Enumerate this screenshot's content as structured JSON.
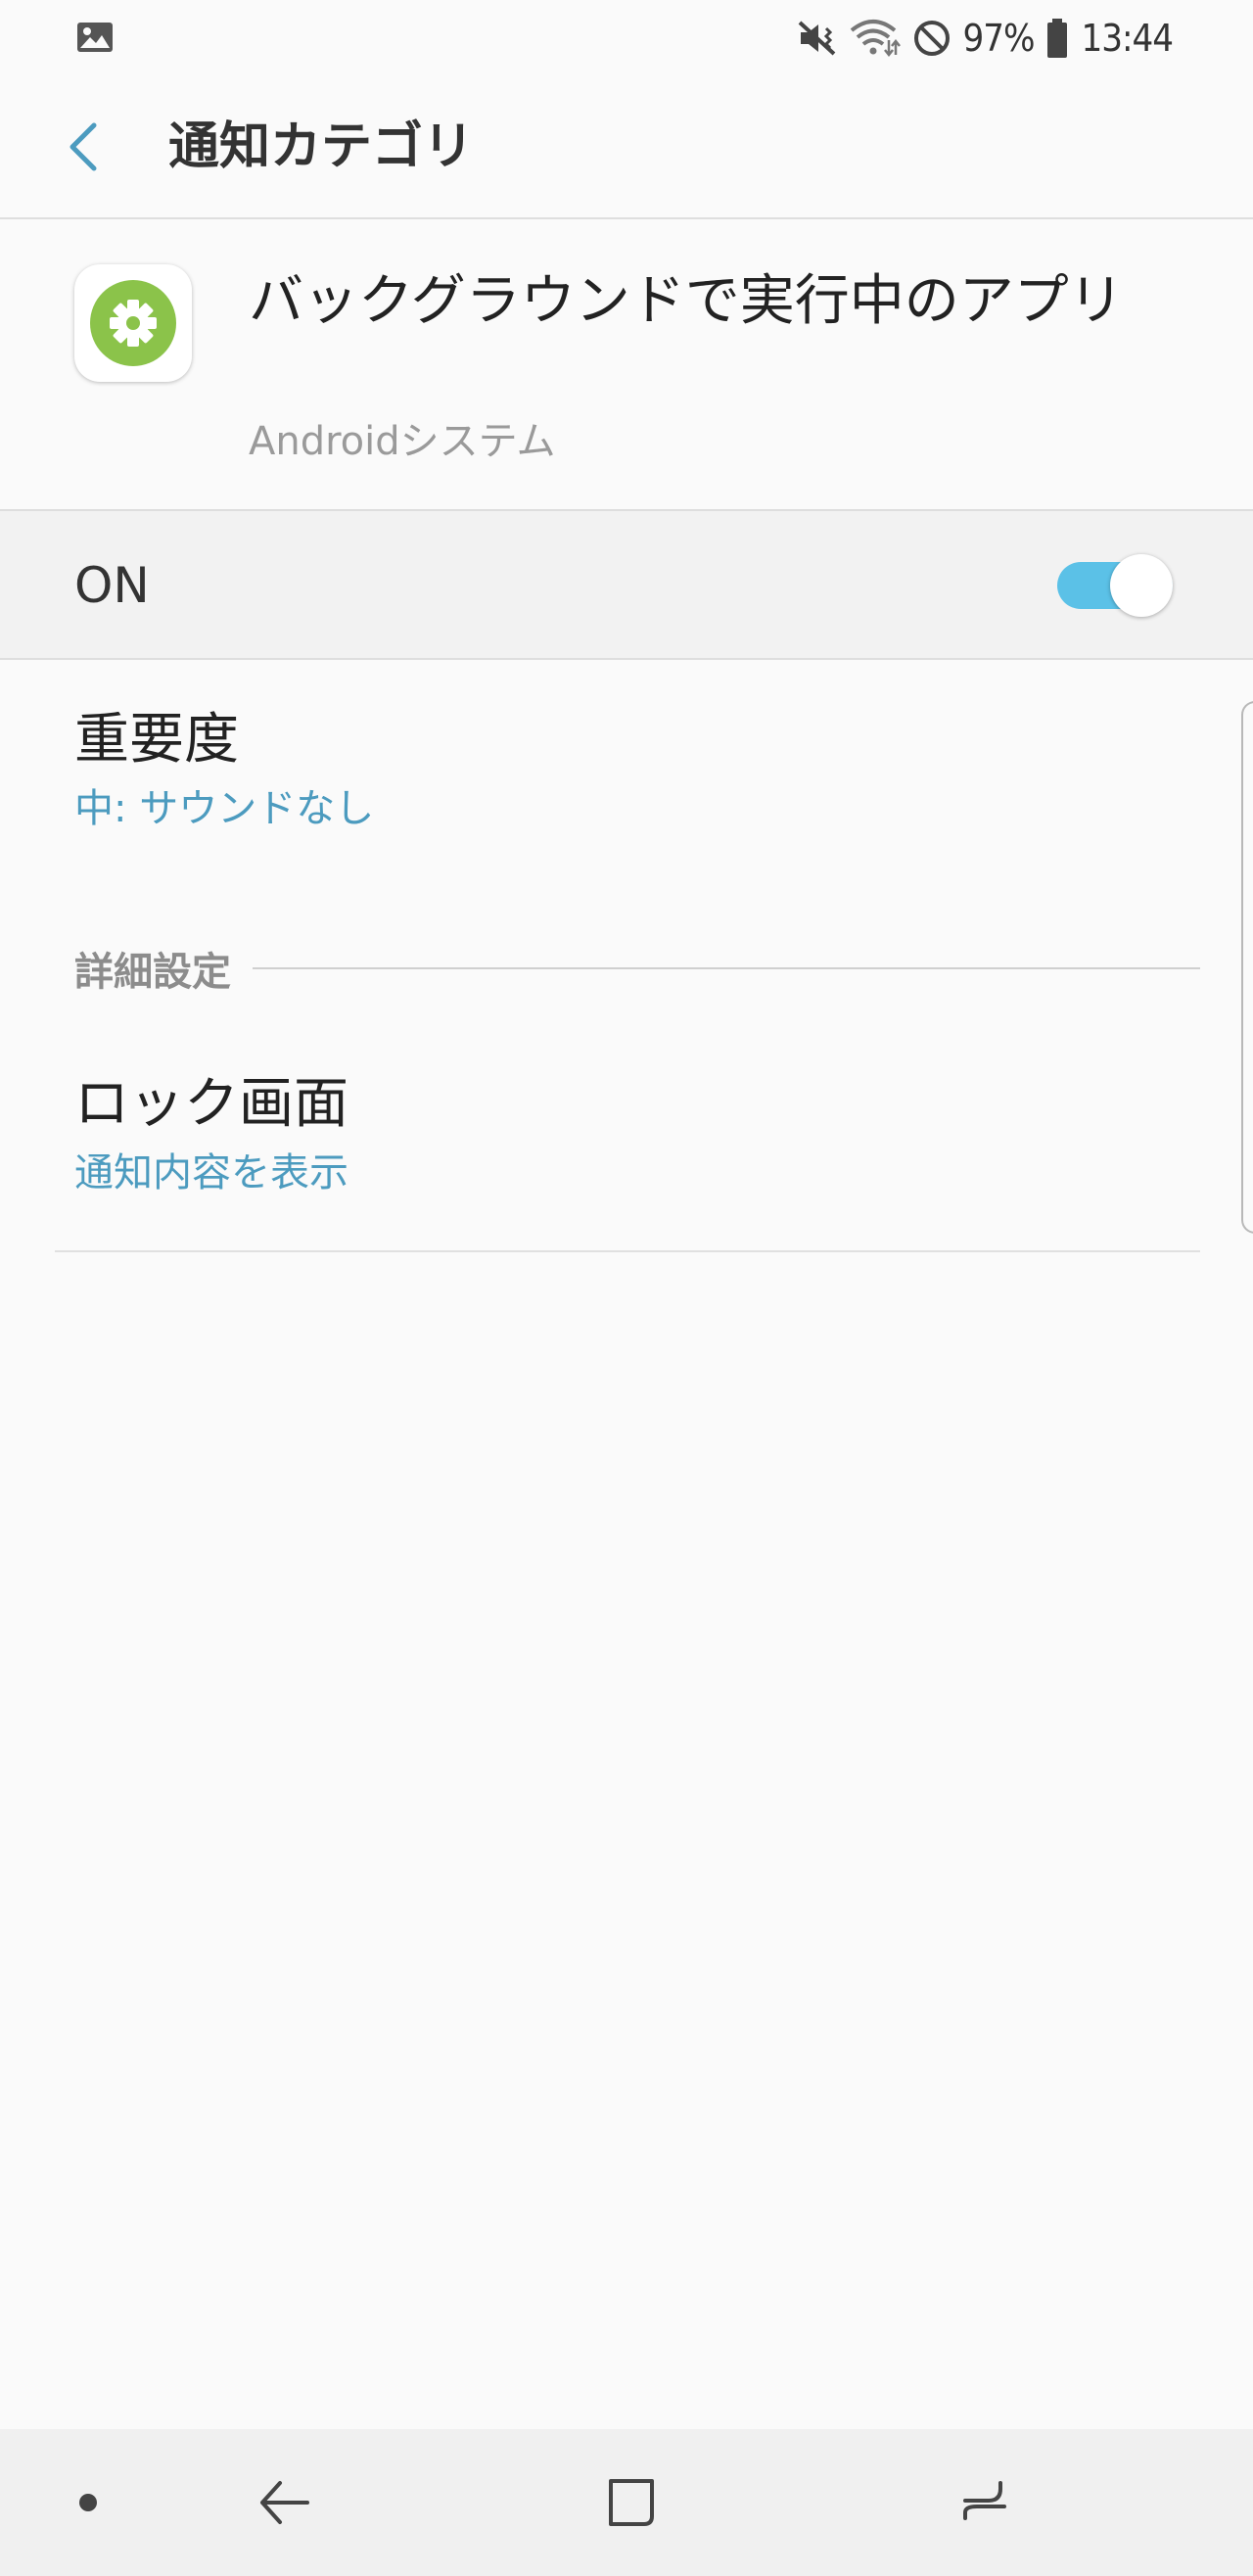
{
  "status_bar": {
    "battery_percent": "97%",
    "time": "13:44",
    "icons": [
      "gallery-icon",
      "mute-vibrate-icon",
      "wifi-icon",
      "do-not-disturb-icon",
      "battery-icon"
    ]
  },
  "header": {
    "title": "通知カテゴリ",
    "back_icon": "chevron-left-icon"
  },
  "app_info": {
    "name": "バックグラウンドで実行中のアプリ",
    "subtitle": "Androidシステム",
    "icon": "settings-gear-icon",
    "icon_color": "#8bc34a"
  },
  "master_switch": {
    "label": "ON",
    "state": "on",
    "accent_color": "#5bc1e7"
  },
  "settings": {
    "importance": {
      "title": "重要度",
      "value": "中: サウンドなし"
    },
    "advanced_header": "詳細設定",
    "lock_screen": {
      "title": "ロック画面",
      "value": "通知内容を表示"
    }
  },
  "nav_bar": {
    "items": [
      "dot-icon",
      "back-arrow-icon",
      "home-square-icon",
      "recent-apps-icon"
    ]
  }
}
